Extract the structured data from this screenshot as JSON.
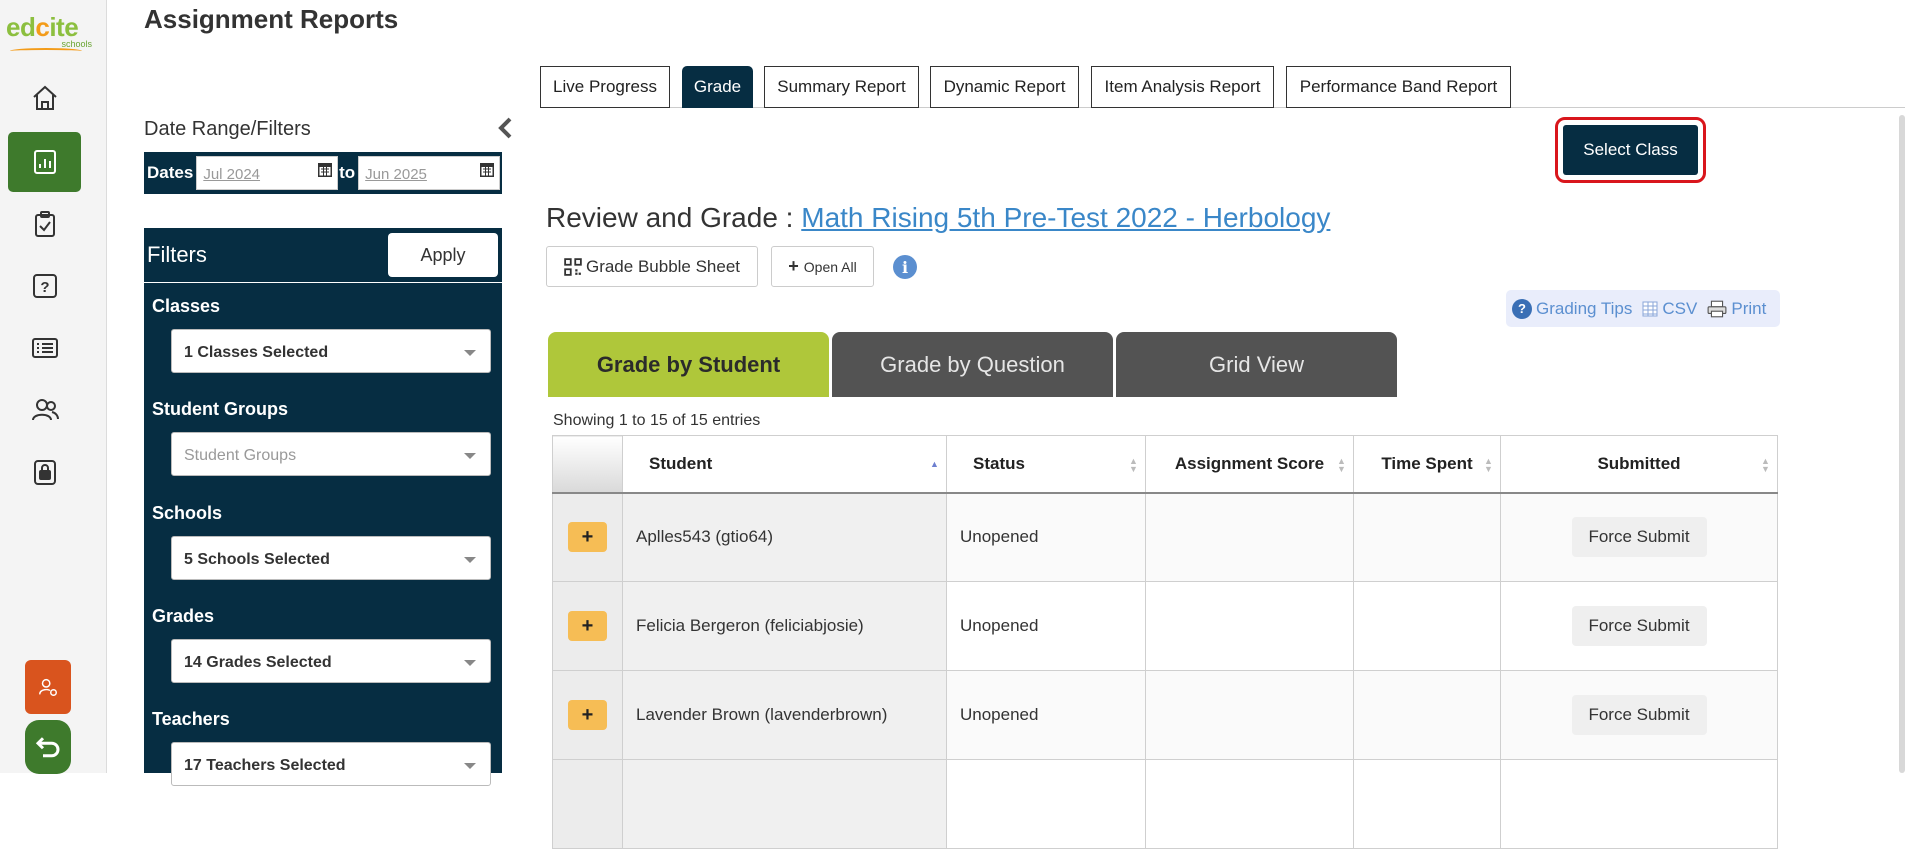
{
  "brand": {
    "name_part1": "ed",
    "name_part2": "c",
    "name_part3": "ite",
    "subtitle": "schools"
  },
  "page": {
    "title": "Assignment Reports"
  },
  "sidebar": {
    "items": [
      {
        "name": "home",
        "icon": "home-icon"
      },
      {
        "name": "reports",
        "icon": "bar-chart-icon",
        "active": true
      },
      {
        "name": "assignments",
        "icon": "clipboard-check-icon"
      },
      {
        "name": "questions",
        "icon": "question-icon"
      },
      {
        "name": "lists",
        "icon": "list-icon"
      },
      {
        "name": "users",
        "icon": "users-icon"
      },
      {
        "name": "locked",
        "icon": "lock-icon"
      }
    ],
    "bottom": [
      {
        "name": "user-settings",
        "icon": "user-gear-icon",
        "color": "#d9541e"
      },
      {
        "name": "back",
        "icon": "return-icon",
        "color": "#3e7a2c"
      }
    ]
  },
  "filters": {
    "heading": "Date Range/Filters",
    "dates_label": "Dates",
    "to_label": "to",
    "date_from": "Jul 2024",
    "date_to": "Jun 2025",
    "panel_title": "Filters",
    "apply_label": "Apply",
    "groups": [
      {
        "label": "Classes",
        "value": "1 Classes Selected"
      },
      {
        "label": "Student Groups",
        "value": "Student Groups",
        "placeholder": true
      },
      {
        "label": "Schools",
        "value": "5 Schools Selected"
      },
      {
        "label": "Grades",
        "value": "14 Grades Selected"
      },
      {
        "label": "Teachers",
        "value": "17 Teachers Selected"
      }
    ]
  },
  "tabs": [
    {
      "label": "Live Progress"
    },
    {
      "label": "Grade",
      "active": true
    },
    {
      "label": "Summary Report"
    },
    {
      "label": "Dynamic Report"
    },
    {
      "label": "Item Analysis Report"
    },
    {
      "label": "Performance Band Report"
    }
  ],
  "select_class_label": "Select Class",
  "review": {
    "prefix": "Review and Grade : ",
    "assignment_link": "Math Rising 5th Pre-Test 2022 - Herbology",
    "bubble_sheet_label": "Grade Bubble Sheet",
    "open_all_label": "Open All",
    "info_glyph": "i"
  },
  "tools": {
    "grading_tips": "Grading Tips",
    "csv": "CSV",
    "print": "Print"
  },
  "grade_tabs": [
    {
      "label": "Grade by Student",
      "active": true
    },
    {
      "label": "Grade by Question"
    },
    {
      "label": "Grid View"
    }
  ],
  "table": {
    "showing": "Showing 1 to 15 of 15 entries",
    "headers": [
      "",
      "Student",
      "Status",
      "Assignment Score",
      "Time Spent",
      "Submitted"
    ],
    "rows": [
      {
        "student": "Aplles543 (gtio64)",
        "status": "Unopened",
        "score": "",
        "time": "",
        "action": "Force Submit"
      },
      {
        "student": "Felicia Bergeron (feliciabjosie)",
        "status": "Unopened",
        "score": "",
        "time": "",
        "action": "Force Submit"
      },
      {
        "student": "Lavender Brown (lavenderbrown)",
        "status": "Unopened",
        "score": "",
        "time": "",
        "action": "Force Submit"
      }
    ]
  },
  "colors": {
    "navy": "#062d42",
    "green_active": "#3e7a2c",
    "lime_tab": "#afc73a",
    "link_blue": "#3a87c8",
    "highlight_red": "#d9161c"
  }
}
